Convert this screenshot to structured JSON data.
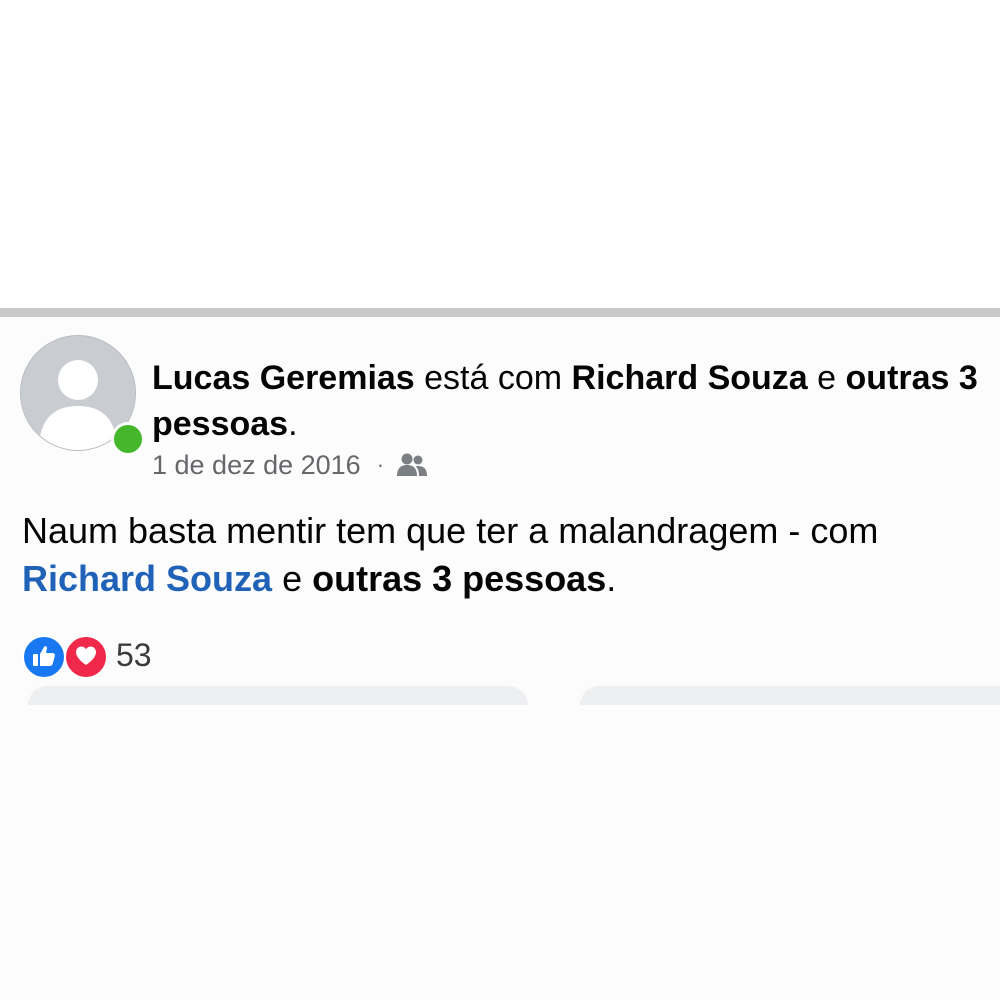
{
  "post": {
    "author": "Lucas Geremias",
    "with_text": " está com ",
    "tagged_person": "Richard Souza",
    "and_text": " e ",
    "others": "outras 3 pessoas",
    "period": ".",
    "date": "1 de dez de 2016",
    "separator": "·",
    "audience_icon": "friends-icon",
    "body": "Naum basta mentir tem que ter a malandragem - com ",
    "body_tagged_person": "Richard Souza",
    "body_and_text": " e ",
    "body_others": "outras 3 pessoas",
    "body_period": "."
  },
  "reactions": {
    "icons": [
      "like-icon",
      "love-icon"
    ],
    "count": "53",
    "colors": {
      "like": "#1878f2",
      "love": "#f0284a"
    }
  },
  "colors": {
    "link_blue": "#1f62b8",
    "online_green": "#44b72b",
    "muted_text": "#65676b"
  }
}
